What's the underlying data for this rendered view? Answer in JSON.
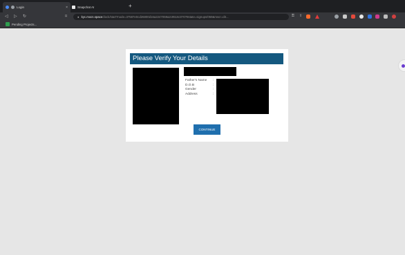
{
  "browser": {
    "tabs": [
      {
        "label": "Login",
        "active": true
      },
      {
        "label": "Snapchat AI",
        "active": false
      }
    ],
    "new_tab": "+",
    "close": "×",
    "url_host": "kyc.mxcn.space",
    "url_path": "/dock/start?node=37587e0cd26800d16a2247059a2c9516c0?0?8state=signups/059&mscr=d3...",
    "bookmark": "Pending Projects..."
  },
  "form": {
    "title": "Please Verify Your Details",
    "fields": [
      {
        "label": "Father's Name",
        "sep": ":"
      },
      {
        "label": "D.O.B",
        "sep": ":"
      },
      {
        "label": "Gender",
        "sep": ":"
      },
      {
        "label": "Address",
        "sep": ":"
      }
    ],
    "continue_label": "CONTINUE"
  },
  "colors": {
    "header": "#14587f",
    "button": "#1f6fae",
    "page_bg": "#e6e6e6",
    "redaction": "#000000"
  }
}
